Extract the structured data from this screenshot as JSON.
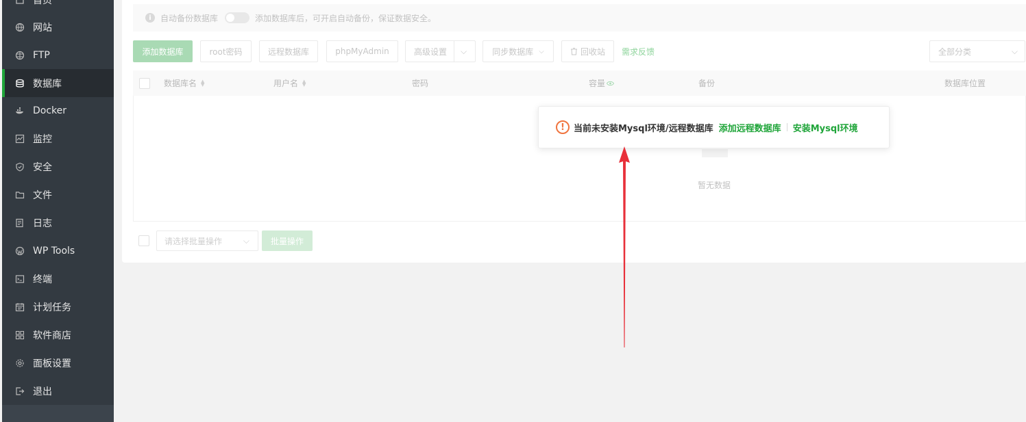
{
  "sidebar": {
    "items": [
      {
        "label": "首页",
        "icon": "home-icon"
      },
      {
        "label": "网站",
        "icon": "globe-icon"
      },
      {
        "label": "FTP",
        "icon": "ftp-globe-icon"
      },
      {
        "label": "数据库",
        "icon": "database-icon",
        "active": true
      },
      {
        "label": "Docker",
        "icon": "docker-icon"
      },
      {
        "label": "监控",
        "icon": "monitor-icon"
      },
      {
        "label": "安全",
        "icon": "shield-icon"
      },
      {
        "label": "文件",
        "icon": "folder-icon"
      },
      {
        "label": "日志",
        "icon": "log-icon"
      },
      {
        "label": "WP Tools",
        "icon": "wordpress-icon"
      },
      {
        "label": "终端",
        "icon": "terminal-icon"
      },
      {
        "label": "计划任务",
        "icon": "calendar-icon"
      },
      {
        "label": "软件商店",
        "icon": "grid-icon"
      },
      {
        "label": "面板设置",
        "icon": "gear-icon"
      },
      {
        "label": "退出",
        "icon": "logout-icon"
      }
    ],
    "accent_color": "#20a53a"
  },
  "notice": {
    "auto_backup_label": "自动备份数据库",
    "auto_backup_hint": "添加数据库后，可开启自动备份，保证数据安全。"
  },
  "toolbar": {
    "add_database": "添加数据库",
    "root_password": "root密码",
    "remote_database": "远程数据库",
    "phpmyadmin": "phpMyAdmin",
    "advanced_settings": "高级设置",
    "sync_database": "同步数据库",
    "recycle_bin": "回收站",
    "feedback": "需求反馈",
    "category_select": "全部分类"
  },
  "table": {
    "columns": [
      "数据库名",
      "用户名",
      "密码",
      "容量",
      "备份",
      "数据库位置"
    ],
    "empty_text": "暂无数据"
  },
  "footer": {
    "batch_select_placeholder": "请选择批量操作",
    "batch_button": "批量操作"
  },
  "popup": {
    "message": "当前未安装Mysql环境/远程数据库",
    "link_add_remote": "添加远程数据库",
    "link_install_mysql": "安装Mysql环境"
  }
}
